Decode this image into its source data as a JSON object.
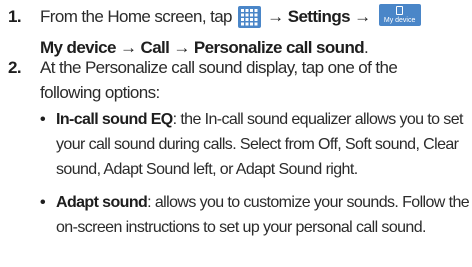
{
  "steps": [
    {
      "number": "1.",
      "line1_prefix": "From the Home screen, tap",
      "arrow1": "→",
      "settings": "Settings",
      "arrow2": "→",
      "mydevice_icon_label": "My device",
      "line2": "My device → Call → Personalize call sound",
      "line2_end": "."
    },
    {
      "number": "2.",
      "line1": "At the Personalize call sound display, tap one of the",
      "line2": "following options:"
    }
  ],
  "options": [
    {
      "bullet": "•",
      "term": "In-call sound EQ",
      "line1_rest": ": the In-call sound equalizer allows you to set",
      "line2": "your call sound during calls. Select from Off, Soft sound, Clear",
      "line3": "sound, Adapt Sound left, or Adapt Sound right."
    },
    {
      "bullet": "•",
      "term": "Adapt sound",
      "line1_rest": ": allows you to customize your sounds. Follow the",
      "line2": "on-screen instructions to set up your personal call sound."
    }
  ],
  "colors": {
    "apps_icon": "#4a86c8",
    "mydevice_icon": "#4a86c8",
    "text": "#2b2b2b"
  },
  "icons": {
    "apps": "apps-grid-icon",
    "mydevice": "my-device-icon"
  }
}
